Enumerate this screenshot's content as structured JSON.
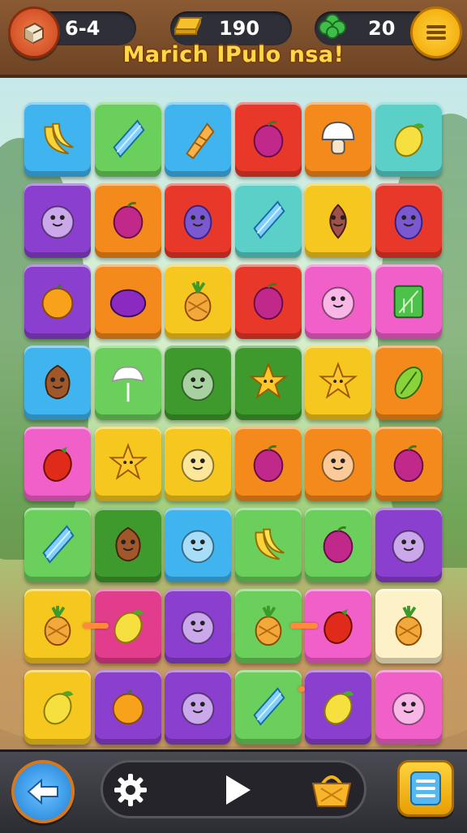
{
  "hud": {
    "level_value": "6-4",
    "coins_value": "190",
    "leaves_value": "20",
    "title": "Marich IPulo nsa!"
  },
  "colors": {
    "blue": "#3fb4ee",
    "green": "#6bcf5c",
    "red": "#e8382a",
    "orange": "#f58a1c",
    "teal": "#5ad0c8",
    "purple": "#8b3fcf",
    "yellow": "#f6c81f",
    "pink": "#f060c8",
    "darkgreen": "#3f9a2e",
    "magenta": "#e23c8c",
    "cream": "#fdf1c8",
    "connector": "#ff8a3c"
  },
  "board": {
    "rows": 8,
    "cols": 6,
    "tiles": [
      [
        "blue:banana",
        "green:crystal",
        "blue:carrot",
        "red:plum",
        "orange:mushroom",
        "teal:lemon"
      ],
      [
        "purple:face",
        "orange:plum",
        "red:eggplant",
        "teal:crystal",
        "yellow:onion",
        "red:eggplant"
      ],
      [
        "purple:orange",
        "orange:grape",
        "yellow:pineapple",
        "red:plum",
        "pink:face",
        "pink:leafcard"
      ],
      [
        "blue:cocoa",
        "green:flower",
        "darkgreen:face",
        "darkgreen:star",
        "yellow:star",
        "orange:leaf"
      ],
      [
        "pink:tomato",
        "yellow:star",
        "yellow:face",
        "orange:plum",
        "orange:face",
        "orange:plum"
      ],
      [
        "green:crystal",
        "darkgreen:cocoa",
        "blue:face",
        "green:banana",
        "green:plum",
        "purple:face"
      ],
      [
        "yellow:pineapple",
        "magenta:lemon",
        "purple:face",
        "green:pineapple",
        "pink:tomato",
        "cream:pineapple"
      ],
      [
        "yellow:lemon",
        "purple:orange",
        "purple:face",
        "green:crystal",
        "purple:lemon",
        "pink:face"
      ]
    ]
  },
  "controls": {
    "back_icon": "arrow-left-icon",
    "settings_icon": "gear-icon",
    "play_icon": "play-icon",
    "shop_icon": "basket-icon",
    "menu_icon": "list-icon"
  }
}
